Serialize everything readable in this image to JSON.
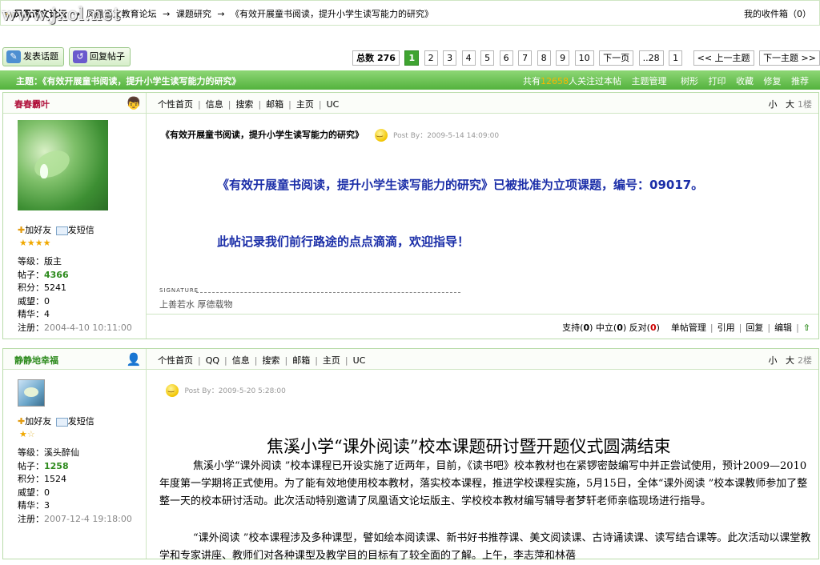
{
  "breadcrumb": {
    "forum_name": "凤凰语文论坛",
    "sep1": "→",
    "board_parent": "凤凰语文教育论坛",
    "sep2": "→",
    "board": "课题研究",
    "sep3": "→",
    "topic": "《有效开展童书阅读，提升小学生读写能力的研究》",
    "inbox": "我的收件箱（0）"
  },
  "watermark": "www.jxol.net",
  "actions": {
    "new_topic": "发表话题",
    "reply": "回复帖子"
  },
  "pager": {
    "total_label": "总数 276",
    "pages": [
      "1",
      "2",
      "3",
      "4",
      "5",
      "6",
      "7",
      "8",
      "9",
      "10"
    ],
    "next": "下一页",
    "last": "..28",
    "jump": "1",
    "prev_topic": "<< 上一主题",
    "next_topic": "下一主题 >>"
  },
  "topic_header": {
    "title": "主题：《有效开展童书阅读，提升小学生读写能力的研究》",
    "count_prefix": "共有",
    "count": "12658",
    "count_suffix": "人关注过本帖",
    "manage": "主题管理",
    "tree": "树形",
    "print": "打印",
    "favorite": "收藏",
    "edit": "修复",
    "recommend": "推荐"
  },
  "posts": [
    {
      "username": "春春霸叶",
      "add_friend": "加好友",
      "send_msg": "发短信",
      "stars": "★★★★",
      "stars_off": "",
      "info": {
        "level_label": "等级：",
        "level": "版主",
        "posts_label": "帖子：",
        "posts": "4366",
        "score_label": "积分：",
        "score": "5241",
        "prestige_label": "威望：",
        "prestige": "0",
        "elite_label": "精华：",
        "elite": "4",
        "reg_label": "注册：",
        "reg": "2004-4-10 10:11:00"
      },
      "nav": [
        "个性首页",
        "信息",
        "搜索",
        "邮箱",
        "主页",
        "UC"
      ],
      "font_small": "小",
      "font_big": "大",
      "floor": "1楼",
      "subject": "《有效开展童书阅读，提升小学生读写能力的研究》",
      "postby": "Post By：2009-5-14 14:09:00",
      "line1": "《有效开展童书阅读，提升小学生读写能力的研究》已被批准为立项课题，编号：09017。",
      "line2": "此帖记录我们前行路途的点点滴滴，欢迎指导！",
      "sig_label": "SIGNATURE",
      "signature": "上善若水 厚德载物",
      "support_label": "支持",
      "support": "0",
      "neutral_label": "中立",
      "neutral": "0",
      "oppose_label": "反对",
      "oppose": "0",
      "manage": "单帖管理",
      "quote": "引用",
      "reply": "回复",
      "edit": "编辑"
    },
    {
      "username": "静静地幸福",
      "add_friend": "加好友",
      "send_msg": "发短信",
      "stars": "★",
      "stars_off": "☆",
      "info": {
        "level_label": "等级：",
        "level": "溪头醉仙",
        "posts_label": "帖子：",
        "posts": "1258",
        "score_label": "积分：",
        "score": "1524",
        "prestige_label": "威望：",
        "prestige": "0",
        "elite_label": "精华：",
        "elite": "3",
        "reg_label": "注册：",
        "reg": "2007-12-4 19:18:00"
      },
      "nav": [
        "个性首页",
        "QQ",
        "信息",
        "搜索",
        "邮箱",
        "主页",
        "UC"
      ],
      "font_small": "小",
      "font_big": "大",
      "floor": "2楼",
      "postby": "Post By：2009-5-20 5:28:00",
      "article_title": "焦溪小学“课外阅读”校本课题研讨暨开题仪式圆满结束",
      "para1": "焦溪小学“课外阅读 ”校本课程已开设实施了近两年，目前，《读书吧》校本教材也在紧锣密鼓编写中并正尝试使用，预计2009—2010年度第一学期将正式使用。为了能有效地使用校本教材，落实校本课程，推进学校课程实施，5月15日，全体“课外阅读 ”校本课教师参加了整整一天的校本研讨活动。此次活动特别邀请了凤凰语文论坛版主、学校校本教材编写辅导者梦轩老师亲临现场进行指导。",
      "para2": "“课外阅读 ”校本课程涉及多种课型，譬如绘本阅读课、新书好书推荐课、美文阅读课、古诗诵读课、读写结合课等。此次活动以课堂教学和专家讲座、教师们对各种课型及教学目的目标有了较全面的了解。上午，李志萍和林蓓"
    }
  ]
}
